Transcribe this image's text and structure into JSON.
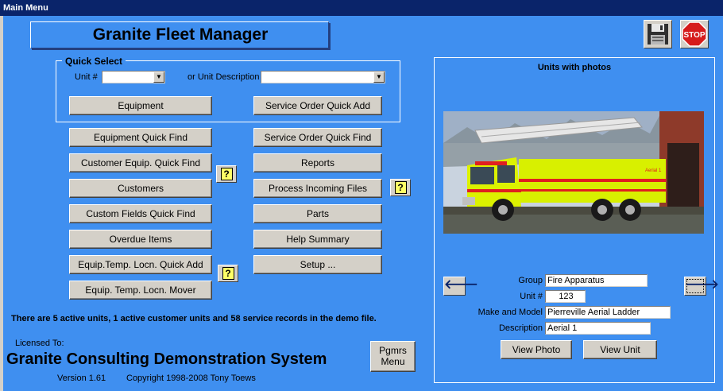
{
  "window": {
    "title": "Main Menu"
  },
  "app_title": "Granite Fleet Manager",
  "quick_select": {
    "legend": "Quick Select",
    "unit_label": "Unit #",
    "unit_value": "",
    "desc_label": "or Unit Description",
    "desc_value": "",
    "equipment_btn": "Equipment",
    "so_quick_add_btn": "Service Order Quick Add"
  },
  "left_buttons": [
    "Equipment Quick Find",
    "Customer Equip. Quick Find",
    "Customers",
    "Custom Fields Quick Find",
    "Overdue Items",
    "Equip.Temp. Locn. Quick Add",
    "Equip. Temp. Locn. Mover"
  ],
  "right_buttons": [
    "Service Order Quick Find",
    "Reports",
    "Process Incoming Files",
    "Parts",
    "Help Summary",
    "Setup ..."
  ],
  "help_glyph": "?",
  "status_text": "There are 5 active units, 1 active customer units and 58 service records in the demo file.",
  "licensed_to_label": "Licensed To:",
  "company": "Granite Consulting Demonstration System",
  "version": "Version 1.61",
  "copyright": "Copyright 1998-2008 Tony Toews",
  "pgmrs_menu_btn": {
    "line1": "Pgmrs",
    "line2": "Menu"
  },
  "stop_label": "STOP",
  "photos_panel": {
    "title": "Units with photos",
    "photo_text": "Aerial 1",
    "group_label": "Group",
    "group_value": "Fire Apparatus",
    "unit_label": "Unit #",
    "unit_value": "123",
    "make_label": "Make and Model",
    "make_value": "Pierreville Aerial Ladder",
    "desc_label": "Description",
    "desc_value": "Aerial 1",
    "view_photo_btn": "View Photo",
    "view_unit_btn": "View Unit",
    "prev_arrow": "🡐",
    "next_arrow": "🡒"
  },
  "icons": {
    "save": "floppy-disk-icon",
    "stop": "stop-sign-icon",
    "prev": "arrow-left-icon",
    "next": "arrow-right-icon"
  },
  "colors": {
    "background": "#3f8ff0",
    "titlebar": "#0a246a",
    "button_face": "#d4d0c8",
    "stop_red": "#d61c1c",
    "help_yellow": "#ffff66"
  }
}
